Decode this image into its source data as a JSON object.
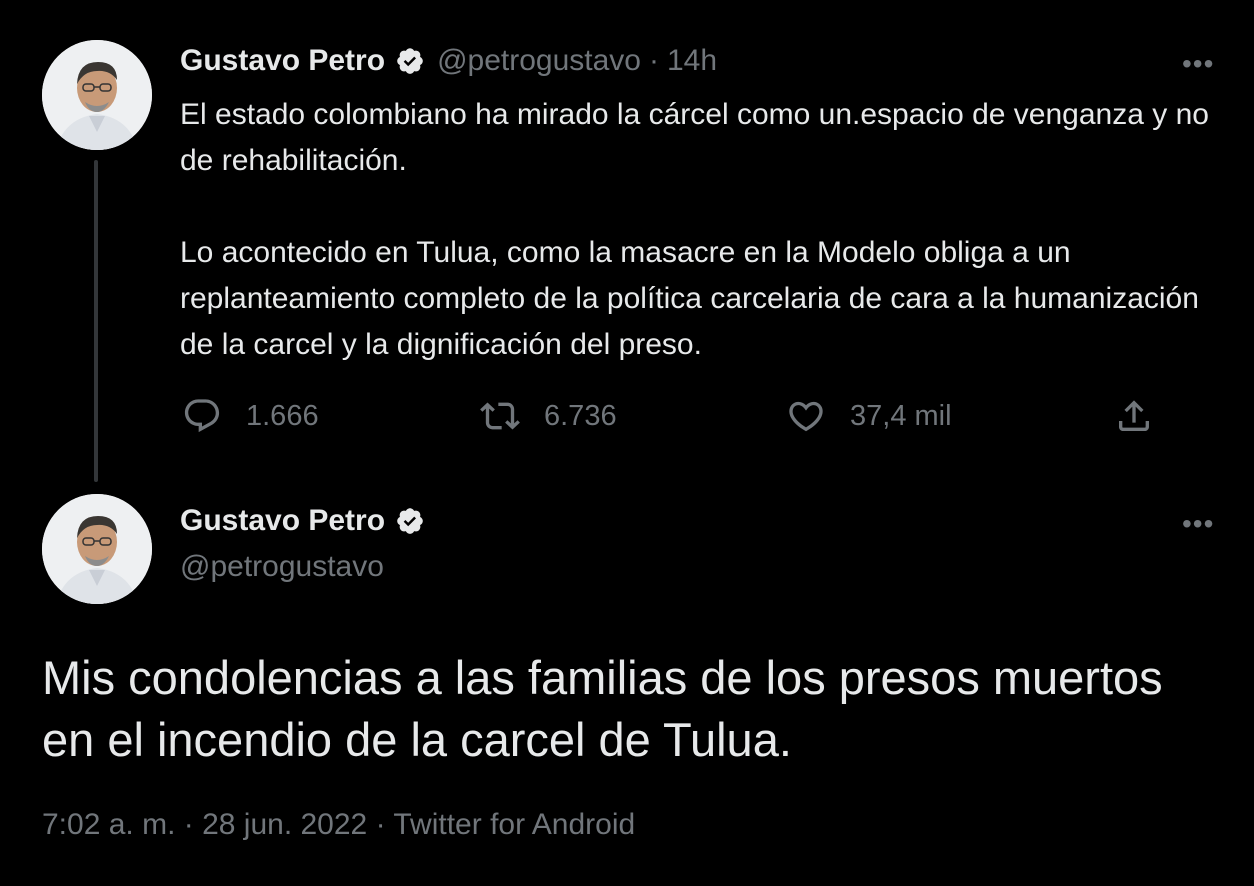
{
  "tweet1": {
    "author_name": "Gustavo Petro",
    "handle": "@petrogustavo",
    "separator": "·",
    "time": "14h",
    "more": "•••",
    "paragraphs": [
      "El estado colombiano ha mirado la cárcel como un.espacio de venganza y no de rehabilitación.",
      "Lo acontecido en Tulua, como la masacre en la Modelo obliga a un replanteamiento completo de la política carcelaria de cara a la humanización de la carcel y la dignificación del preso."
    ],
    "actions": {
      "replies": "1.666",
      "retweets": "6.736",
      "likes": "37,4 mil"
    }
  },
  "tweet2": {
    "author_name": "Gustavo Petro",
    "handle": "@petrogustavo",
    "more": "•••",
    "text": "Mis condolencias a las familias de los presos muertos en el incendio de la carcel de Tulua.",
    "meta": {
      "time": "7:02 a. m.",
      "sep": "·",
      "date": "28 jun. 2022",
      "source": "Twitter for Android"
    }
  },
  "colors": {
    "background": "#000000",
    "text": "#e7e9ea",
    "secondary": "#71767b",
    "thread_line": "#333639"
  },
  "icons": [
    "verified-badge-icon",
    "more-icon",
    "reply-icon",
    "retweet-icon",
    "like-icon",
    "share-icon"
  ]
}
